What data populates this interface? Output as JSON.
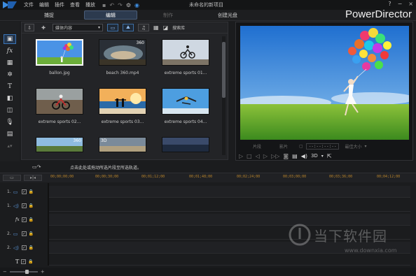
{
  "app": {
    "menu": [
      "文件",
      "编辑",
      "插件",
      "查看",
      "播放"
    ],
    "project_title": "未命名的新项目",
    "help": "?",
    "brand": "PowerDirector"
  },
  "modes": {
    "capture": "捕捉",
    "edit": "编辑",
    "produce": "制作",
    "disc": "创建光盘"
  },
  "library": {
    "filter_label": "媒体内容",
    "search_placeholder": "搜索库",
    "items": [
      {
        "caption": "ballon.jpg",
        "badge": ""
      },
      {
        "caption": "beach 360.mp4",
        "badge": "360"
      },
      {
        "caption": "extreme sports 01...",
        "badge": ""
      },
      {
        "caption": "extreme sports 02...",
        "badge": ""
      },
      {
        "caption": "extreme sports 03...",
        "badge": ""
      },
      {
        "caption": "extreme sports 04...",
        "badge": ""
      },
      {
        "caption": "",
        "badge": "360"
      },
      {
        "caption": "",
        "badge": "3D"
      },
      {
        "caption": "",
        "badge": ""
      }
    ]
  },
  "preview": {
    "timecode": "--:--:--:--",
    "mode_clip": "片段",
    "mode_movie": "影片",
    "quality": "最佳大小",
    "mode_3d": "3D"
  },
  "timeline": {
    "hint": "点击此处或拖动所选片段至所选轨道。",
    "ticks": [
      "00;00;00;00",
      "00;00;30;00",
      "00;01;12;00",
      "00;01;48;00",
      "00;02;24;00",
      "00;03;00;00",
      "00;03;36;00",
      "00;04;12;00"
    ],
    "tracks": [
      {
        "label": "1.",
        "icon": "video-track-icon",
        "checked": "✓"
      },
      {
        "label": "1.",
        "icon": "audio-track-icon",
        "checked": "✓"
      },
      {
        "label": "fx",
        "icon": "fx-track-icon",
        "checked": "✓"
      },
      {
        "label": "2.",
        "icon": "video-track-icon",
        "checked": "✓"
      },
      {
        "label": "2.",
        "icon": "audio-track-icon",
        "checked": "✓"
      },
      {
        "label": "T",
        "icon": "title-track-icon",
        "checked": "✓"
      }
    ]
  },
  "watermark": {
    "text": "当下软件园",
    "url": "www.downxia.com"
  },
  "colors": {
    "accent": "#3a75b9",
    "ruler": "#b9852c",
    "bg": "#1b1c1e"
  }
}
